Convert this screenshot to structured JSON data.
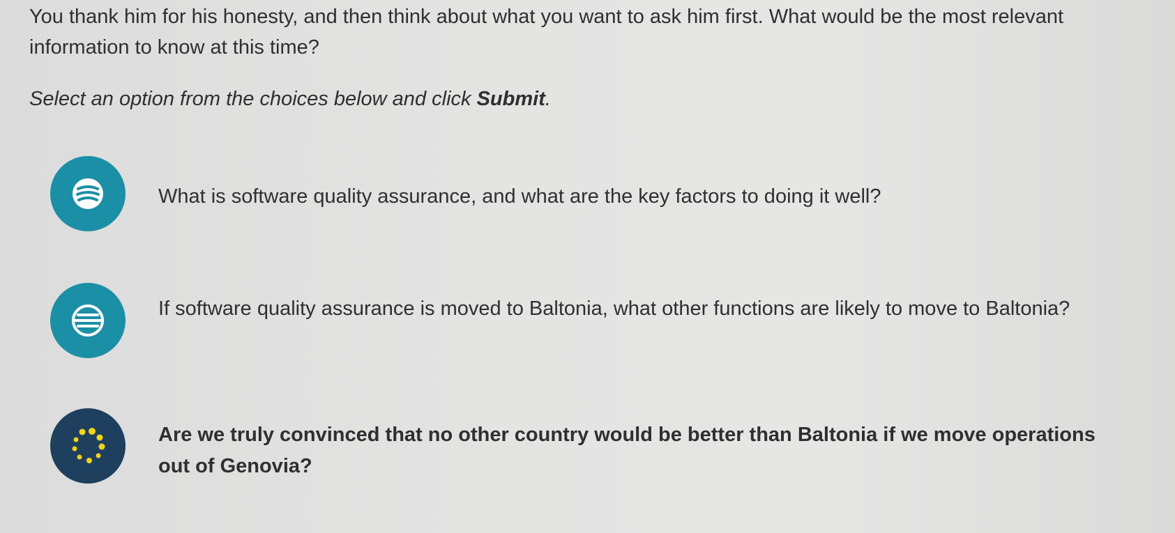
{
  "prompt": {
    "intro": "You thank him for his honesty, and then think about what you want to ask him first. What would be the most relevant information to know at this time?",
    "instruction_prefix": "Select an option from the choices below and click ",
    "instruction_bold": "Submit",
    "instruction_suffix": "."
  },
  "options": [
    {
      "icon": "three-lines-icon",
      "text": "What is software quality assurance, and what are the key factors to doing it well?",
      "color": "#1b8fa6"
    },
    {
      "icon": "globe-lines-icon",
      "text": "If software quality assurance is moved to Baltonia, what other functions are likely to move to Baltonia?",
      "color": "#1b8fa6"
    },
    {
      "icon": "dots-circle-icon",
      "text": "Are we truly convinced that no other country would be better than Baltonia if we move operations out of Genovia?",
      "color": "#1e3f5d",
      "dots_color": "#f2d21b"
    }
  ]
}
